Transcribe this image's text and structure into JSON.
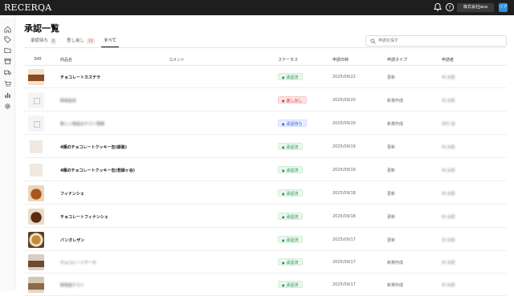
{
  "app": {
    "logo": "RECERQA",
    "company_button": "株式会社Jace",
    "avatar_initials": "リア"
  },
  "page": {
    "title": "承認一覧"
  },
  "tabs": [
    {
      "label": "承認待ち",
      "count": "1"
    },
    {
      "label": "差し戻し",
      "count": "11"
    },
    {
      "label": "すべて"
    }
  ],
  "search": {
    "placeholder": "申請を探す"
  },
  "table": {
    "total": "340",
    "headers": {
      "product": "商品名",
      "comment": "コメント",
      "status": "ステータス",
      "date": "申請日時",
      "type": "申請タイプ",
      "applicant": "申請者"
    },
    "rows": [
      {
        "name": "チョコレートカステラ",
        "status": "承認済",
        "status_kind": "approved",
        "date": "2025/09/22",
        "type": "更新",
        "applicant": "林 由香",
        "thumb": "castella"
      },
      {
        "name": "新商品名",
        "status": "差し戻し",
        "status_kind": "returned",
        "date": "2025/09/20",
        "type": "新規作成",
        "applicant": "林 由香",
        "thumb": "placeholder"
      },
      {
        "name": "新しい商品のテスト登録",
        "status": "承認待ち",
        "status_kind": "pending",
        "date": "2025/09/20",
        "type": "新規作成",
        "applicant": "田中 誠",
        "thumb": "placeholder"
      },
      {
        "name": "4種のチョコレートクッキー缶(銀紫)",
        "status": "承認済",
        "status_kind": "approved",
        "date": "2025/09/19",
        "type": "更新",
        "applicant": "林 由香",
        "thumb": "cookie"
      },
      {
        "name": "4種のチョコレートクッキー缶(若緑ヶ谷)",
        "status": "承認済",
        "status_kind": "approved",
        "date": "2025/09/19",
        "type": "更新",
        "applicant": "林 由香",
        "thumb": "cookie"
      },
      {
        "name": "フィナンシェ",
        "status": "承認済",
        "status_kind": "approved",
        "date": "2025/09/18",
        "type": "更新",
        "applicant": "林 由香",
        "thumb": "financier"
      },
      {
        "name": "チョコレートフィナンシェ",
        "status": "承認済",
        "status_kind": "approved",
        "date": "2025/09/18",
        "type": "更新",
        "applicant": "林 由香",
        "thumb": "financier2"
      },
      {
        "name": "バンオレザン",
        "status": "承認済",
        "status_kind": "approved",
        "date": "2025/09/17",
        "type": "更新",
        "applicant": "林 由香",
        "thumb": "bread"
      },
      {
        "name": "チョコレートケーキ",
        "status": "承認済",
        "status_kind": "approved",
        "date": "2025/09/17",
        "type": "新規作成",
        "applicant": "林 由香",
        "thumb": "box"
      },
      {
        "name": "新商品テスト",
        "status": "承認済",
        "status_kind": "approved",
        "date": "2025/09/17",
        "type": "新規作成",
        "applicant": "林 由香",
        "thumb": "box2"
      }
    ]
  },
  "icons": {
    "bell": "bell-icon",
    "help": "help-icon"
  },
  "colors": {
    "topbar": "#1e1e1e",
    "avatar": "#2f8fe0",
    "approved": "#2a9a4b",
    "returned": "#d43c3c",
    "pending": "#3563d6"
  }
}
